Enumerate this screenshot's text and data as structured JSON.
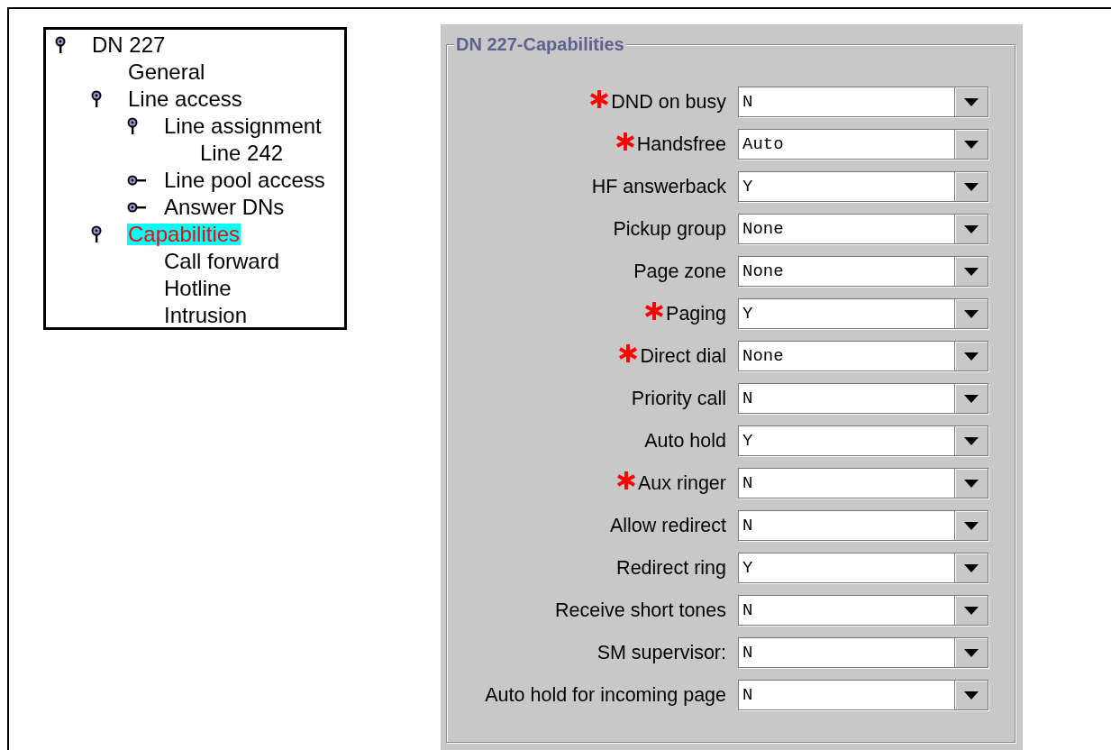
{
  "tree": [
    {
      "label": "DN 227",
      "selected": false,
      "expanded": true,
      "children": [
        {
          "label": "General",
          "selected": false
        },
        {
          "label": "Line access",
          "selected": false,
          "expanded": true,
          "children": [
            {
              "label": "Line assignment",
              "selected": false,
              "expanded": true,
              "children": [
                {
                  "label": "Line 242",
                  "selected": false
                }
              ]
            },
            {
              "label": "Line pool access",
              "selected": false,
              "expanded": false
            },
            {
              "label": "Answer DNs",
              "selected": false,
              "expanded": false
            }
          ]
        },
        {
          "label": "Capabilities",
          "selected": true,
          "expanded": true,
          "children": [
            {
              "label": "Call forward",
              "selected": false
            },
            {
              "label": "Hotline",
              "selected": false
            },
            {
              "label": "Intrusion",
              "selected": false
            }
          ]
        }
      ]
    }
  ],
  "panel": {
    "title": "DN 227-Capabilities",
    "fields": [
      {
        "label": "DND on busy",
        "required": true,
        "value": "N"
      },
      {
        "label": "Handsfree",
        "required": true,
        "value": "Auto"
      },
      {
        "label": "HF answerback",
        "required": false,
        "value": "Y"
      },
      {
        "label": "Pickup group",
        "required": false,
        "value": "None"
      },
      {
        "label": "Page zone",
        "required": false,
        "value": "None"
      },
      {
        "label": "Paging",
        "required": true,
        "value": "Y"
      },
      {
        "label": "Direct dial",
        "required": true,
        "value": "None"
      },
      {
        "label": "Priority call",
        "required": false,
        "value": "N"
      },
      {
        "label": "Auto hold",
        "required": false,
        "value": "Y"
      },
      {
        "label": "Aux ringer",
        "required": true,
        "value": "N"
      },
      {
        "label": "Allow redirect",
        "required": false,
        "value": "N"
      },
      {
        "label": "Redirect ring",
        "required": false,
        "value": "Y"
      },
      {
        "label": "Receive short tones",
        "required": false,
        "value": "N"
      },
      {
        "label": "SM supervisor:",
        "required": false,
        "value": "N"
      },
      {
        "label": "Auto hold for incoming page",
        "required": false,
        "value": "N"
      }
    ]
  }
}
